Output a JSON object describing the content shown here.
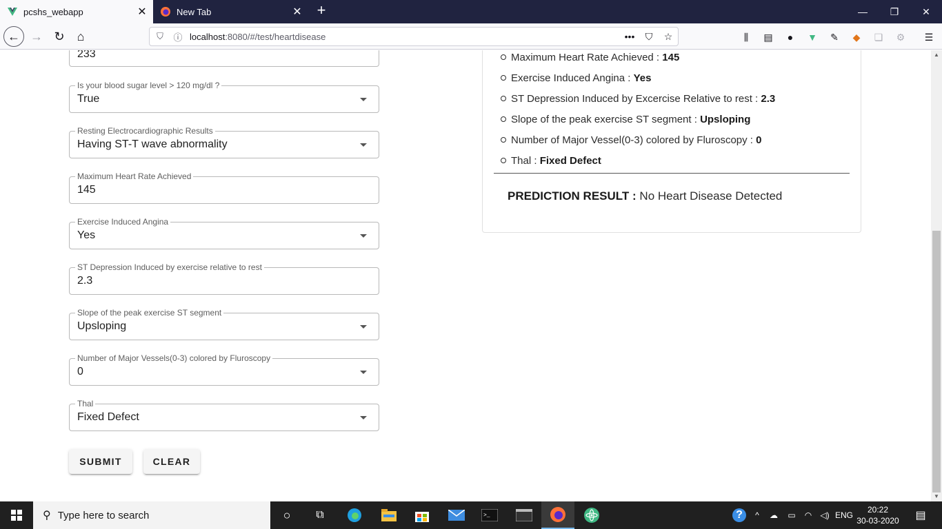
{
  "browser": {
    "tabs": [
      {
        "title": "pcshs_webapp"
      },
      {
        "title": "New Tab"
      }
    ],
    "url_host": "localhost",
    "url_rest": ":8080/#/test/heartdisease"
  },
  "form": {
    "prev_value": "233",
    "fields": [
      {
        "label": "Is your blood sugar level > 120 mg/dl ?",
        "value": "True",
        "type": "select"
      },
      {
        "label": "Resting Electrocardiographic Results",
        "value": "Having ST-T wave abnormality",
        "type": "select"
      },
      {
        "label": "Maximum Heart Rate Achieved",
        "value": "145",
        "type": "text"
      },
      {
        "label": "Exercise Induced Angina",
        "value": "Yes",
        "type": "select"
      },
      {
        "label": "ST Depression Induced by exercise relative to rest",
        "value": "2.3",
        "type": "text"
      },
      {
        "label": "Slope of the peak exercise ST segment",
        "value": "Upsloping",
        "type": "select"
      },
      {
        "label": "Number of Major Vessels(0-3) colored by Fluroscopy",
        "value": "0",
        "type": "select"
      },
      {
        "label": "Thal",
        "value": "Fixed Defect",
        "type": "select"
      }
    ],
    "submit_label": "SUBMIT",
    "clear_label": "CLEAR"
  },
  "summary": {
    "items": [
      {
        "label": "Maximum Heart Rate Achieved :",
        "value": "145"
      },
      {
        "label": "Exercise Induced Angina :",
        "value": "Yes"
      },
      {
        "label": "ST Depression Induced by Excercise Relative to rest :",
        "value": "2.3"
      },
      {
        "label": "Slope of the peak exercise ST segment :",
        "value": "Upsloping"
      },
      {
        "label": "Number of Major Vessel(0-3) colored by Fluroscopy :",
        "value": "0"
      },
      {
        "label": "Thal :",
        "value": "Fixed Defect"
      }
    ],
    "result_label": "PREDICTION RESULT :",
    "result_value": "No Heart Disease Detected"
  },
  "taskbar": {
    "search_placeholder": "Type here to search",
    "language": "ENG",
    "time": "20:22",
    "date": "30-03-2020"
  },
  "colors": {
    "tabbar": "#202340",
    "vue_green": "#41b883",
    "firefox_orange": "#ff7139",
    "taskbar": "#202020"
  }
}
